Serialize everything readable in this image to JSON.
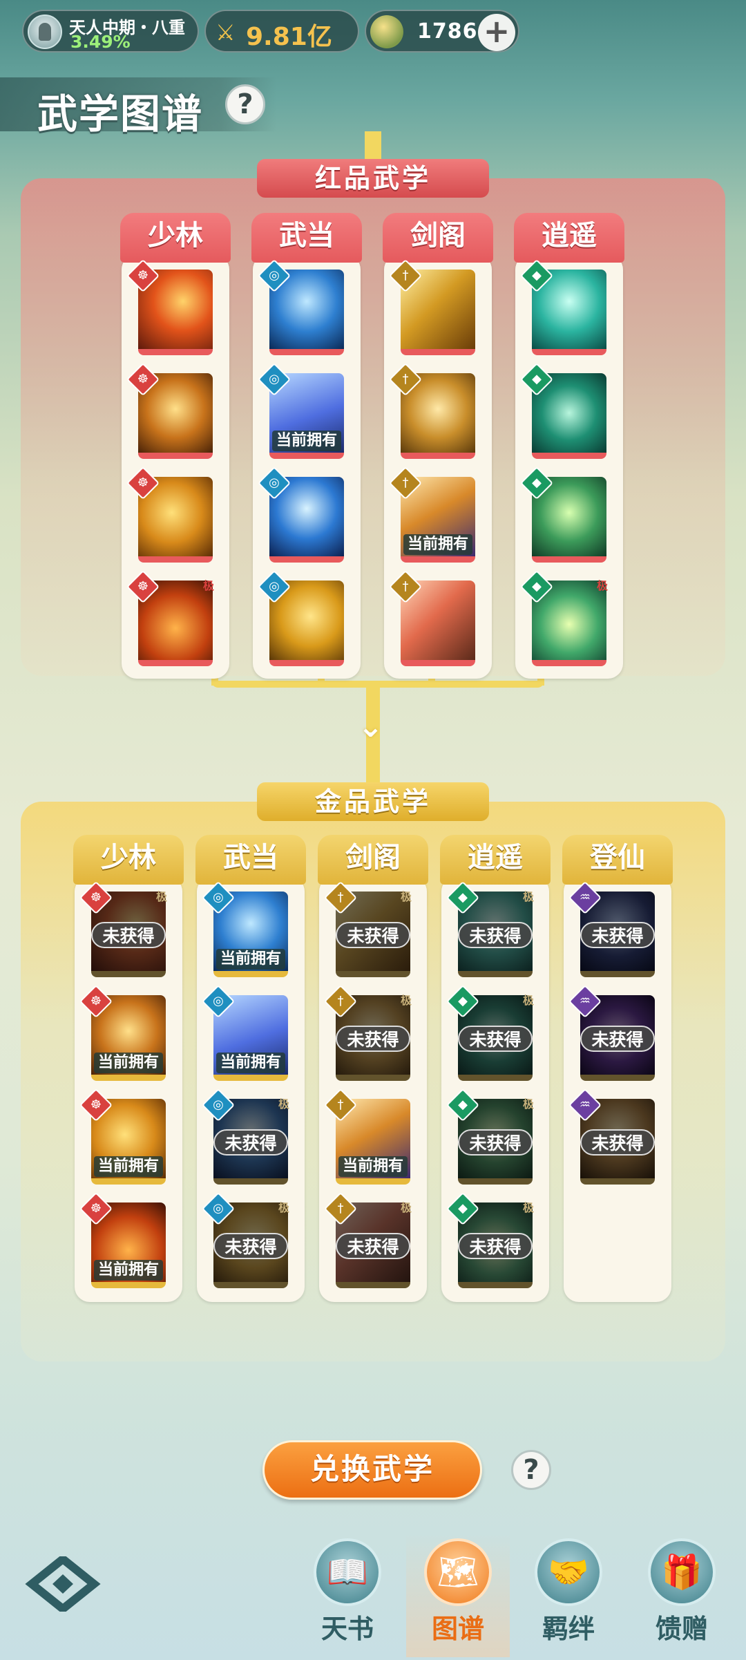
{
  "top_bar": {
    "rank": "天人中期・八重",
    "rank_progress": "3.49%",
    "power": "9.81亿",
    "currency": "1786",
    "add_symbol": "+"
  },
  "page_title": "武学图谱",
  "help_symbol": "?",
  "red_section": {
    "title": "红品武学",
    "columns": [
      {
        "name": "少林",
        "cards": [
          {
            "status": ""
          },
          {
            "status": ""
          },
          {
            "status": ""
          },
          {
            "status": "",
            "tag": "极"
          }
        ]
      },
      {
        "name": "武当",
        "cards": [
          {
            "status": ""
          },
          {
            "status": "当前拥有"
          },
          {
            "status": ""
          },
          {
            "status": ""
          }
        ]
      },
      {
        "name": "剑阁",
        "cards": [
          {
            "status": ""
          },
          {
            "status": ""
          },
          {
            "status": "当前拥有"
          },
          {
            "status": ""
          }
        ]
      },
      {
        "name": "逍遥",
        "cards": [
          {
            "status": ""
          },
          {
            "status": ""
          },
          {
            "status": ""
          },
          {
            "status": "",
            "tag": "极"
          }
        ]
      }
    ]
  },
  "gold_section": {
    "title": "金品武学",
    "columns": [
      {
        "name": "少林",
        "cards": [
          {
            "status": "未获得",
            "tag": "极"
          },
          {
            "status": "当前拥有"
          },
          {
            "status": "当前拥有"
          },
          {
            "status": "当前拥有"
          }
        ]
      },
      {
        "name": "武当",
        "cards": [
          {
            "status": "当前拥有"
          },
          {
            "status": "当前拥有"
          },
          {
            "status": "未获得",
            "tag": "极"
          },
          {
            "status": "未获得",
            "tag": "极"
          }
        ]
      },
      {
        "name": "剑阁",
        "cards": [
          {
            "status": "未获得",
            "tag": "极"
          },
          {
            "status": "未获得",
            "tag": "极"
          },
          {
            "status": "当前拥有"
          },
          {
            "status": "未获得",
            "tag": "极"
          }
        ]
      },
      {
        "name": "逍遥",
        "cards": [
          {
            "status": "未获得",
            "tag": "极"
          },
          {
            "status": "未获得",
            "tag": "极"
          },
          {
            "status": "未获得",
            "tag": "极"
          },
          {
            "status": "未获得",
            "tag": "极"
          }
        ]
      },
      {
        "name": "登仙",
        "cards": [
          {
            "status": "未获得"
          },
          {
            "status": "未获得"
          },
          {
            "status": "未获得"
          }
        ]
      }
    ]
  },
  "exchange_button": "兑换武学",
  "nav": {
    "items": [
      {
        "label": "天书"
      },
      {
        "label": "图谱"
      },
      {
        "label": "羁绊"
      },
      {
        "label": "馈赠"
      }
    ]
  },
  "colors": {
    "red_accent": "#e85a5c",
    "gold_accent": "#e6b93c",
    "active_nav": "#ea6d14"
  }
}
